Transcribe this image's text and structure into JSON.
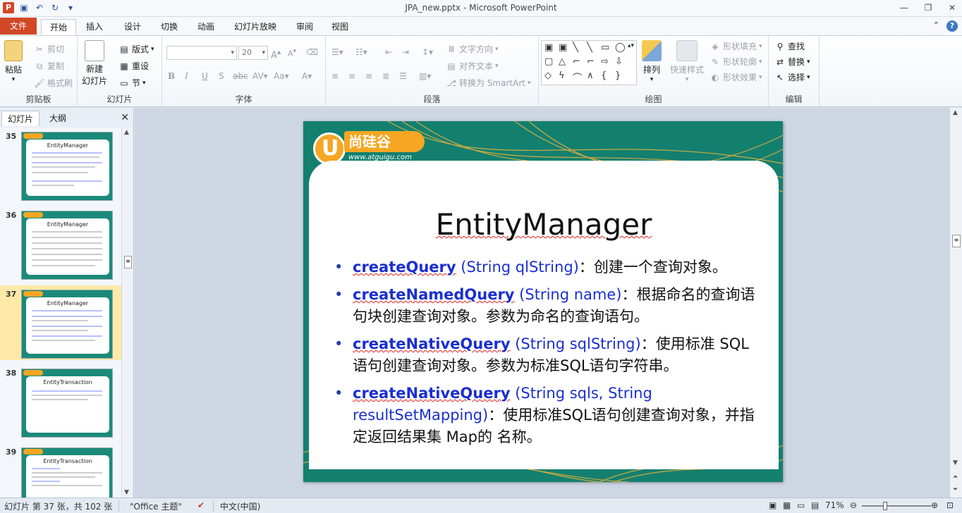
{
  "window": {
    "title": "JPA_new.pptx - Microsoft PowerPoint",
    "app_logo": "P"
  },
  "tabs": {
    "file": "文件",
    "items": [
      "开始",
      "插入",
      "设计",
      "切换",
      "动画",
      "幻灯片放映",
      "审阅",
      "视图"
    ],
    "active": "开始"
  },
  "ribbon": {
    "clipboard": {
      "label": "剪贴板",
      "paste": "粘贴",
      "cut": "剪切",
      "copy": "复制",
      "format_painter": "格式刷"
    },
    "slides": {
      "label": "幻灯片",
      "new_slide": "新建",
      "new_slide_2": "幻灯片",
      "layout": "版式",
      "reset": "重设",
      "section": "节"
    },
    "font": {
      "label": "字体",
      "font_name": "",
      "font_size": "20"
    },
    "paragraph": {
      "label": "段落",
      "text_direction": "文字方向",
      "align_text": "对齐文本",
      "convert_smartart": "转换为 SmartArt"
    },
    "drawing": {
      "label": "绘图",
      "arrange": "排列",
      "quick_styles": "快速样式",
      "shape_fill": "形状填充",
      "shape_outline": "形状轮廓",
      "shape_effects": "形状效果"
    },
    "editing": {
      "label": "编辑",
      "find": "查找",
      "replace": "替换",
      "select": "选择"
    }
  },
  "left_panel": {
    "tab_slides": "幻灯片",
    "tab_outline": "大纲",
    "thumbnails": [
      {
        "num": "35",
        "title": "EntityManager"
      },
      {
        "num": "36",
        "title": "EntityManager"
      },
      {
        "num": "37",
        "title": "EntityManager"
      },
      {
        "num": "38",
        "title": "EntityTransaction"
      },
      {
        "num": "39",
        "title": "EntityTransaction"
      }
    ],
    "selected": "37"
  },
  "slide": {
    "logo_text": "尚硅谷",
    "logo_url": "www.atguigu.com",
    "title": "EntityManager",
    "bullets": [
      {
        "method": "createQuery",
        "params": " (String qlString)",
        "desc": "：创建一个查询对象。"
      },
      {
        "method": "createNamedQuery",
        "params": " (String name)",
        "desc": "：根据命名的查询语句块创建查询对象。参数为命名的查询语句。"
      },
      {
        "method": "createNativeQuery",
        "params": " (String sqlString)",
        "desc": "：使用标准 SQL语句创建查询对象。参数为标准SQL语句字符串。"
      },
      {
        "method": "createNativeQuery",
        "params": " (String sqls, String resultSetMapping)",
        "desc": "：使用标准SQL语句创建查询对象，并指定返回结果集 Map的 名称。"
      }
    ]
  },
  "status": {
    "slide_info": "幻灯片 第 37 张，共 102 张",
    "theme": "\"Office 主题\"",
    "language": "中文(中国)",
    "zoom": "71%"
  },
  "colors": {
    "accent": "#d24726",
    "slide_bg": "#13806f",
    "method_blue": "#1a2fd0",
    "logo_orange": "#f5a623"
  }
}
